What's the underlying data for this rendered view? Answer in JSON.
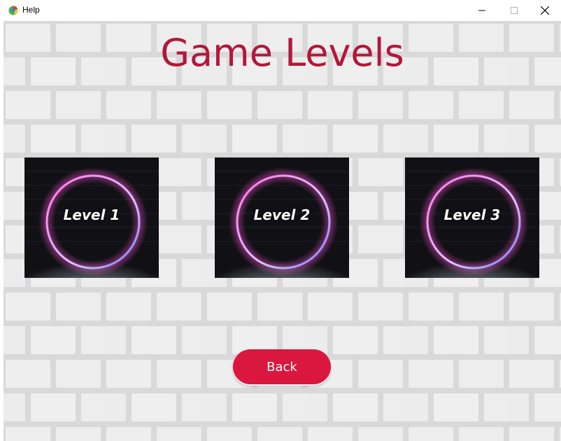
{
  "window": {
    "title": "Help",
    "controls": {
      "minimize_icon": "minimize-icon",
      "maximize_icon": "maximize-icon",
      "close_icon": "close-icon"
    }
  },
  "page": {
    "heading": "Game Levels",
    "levels": [
      {
        "label": "Level 1"
      },
      {
        "label": "Level 2"
      },
      {
        "label": "Level 3"
      }
    ],
    "back_label": "Back"
  },
  "colors": {
    "heading": "#b3173a",
    "button": "#d9173f",
    "wall": "#e6e6e6"
  }
}
